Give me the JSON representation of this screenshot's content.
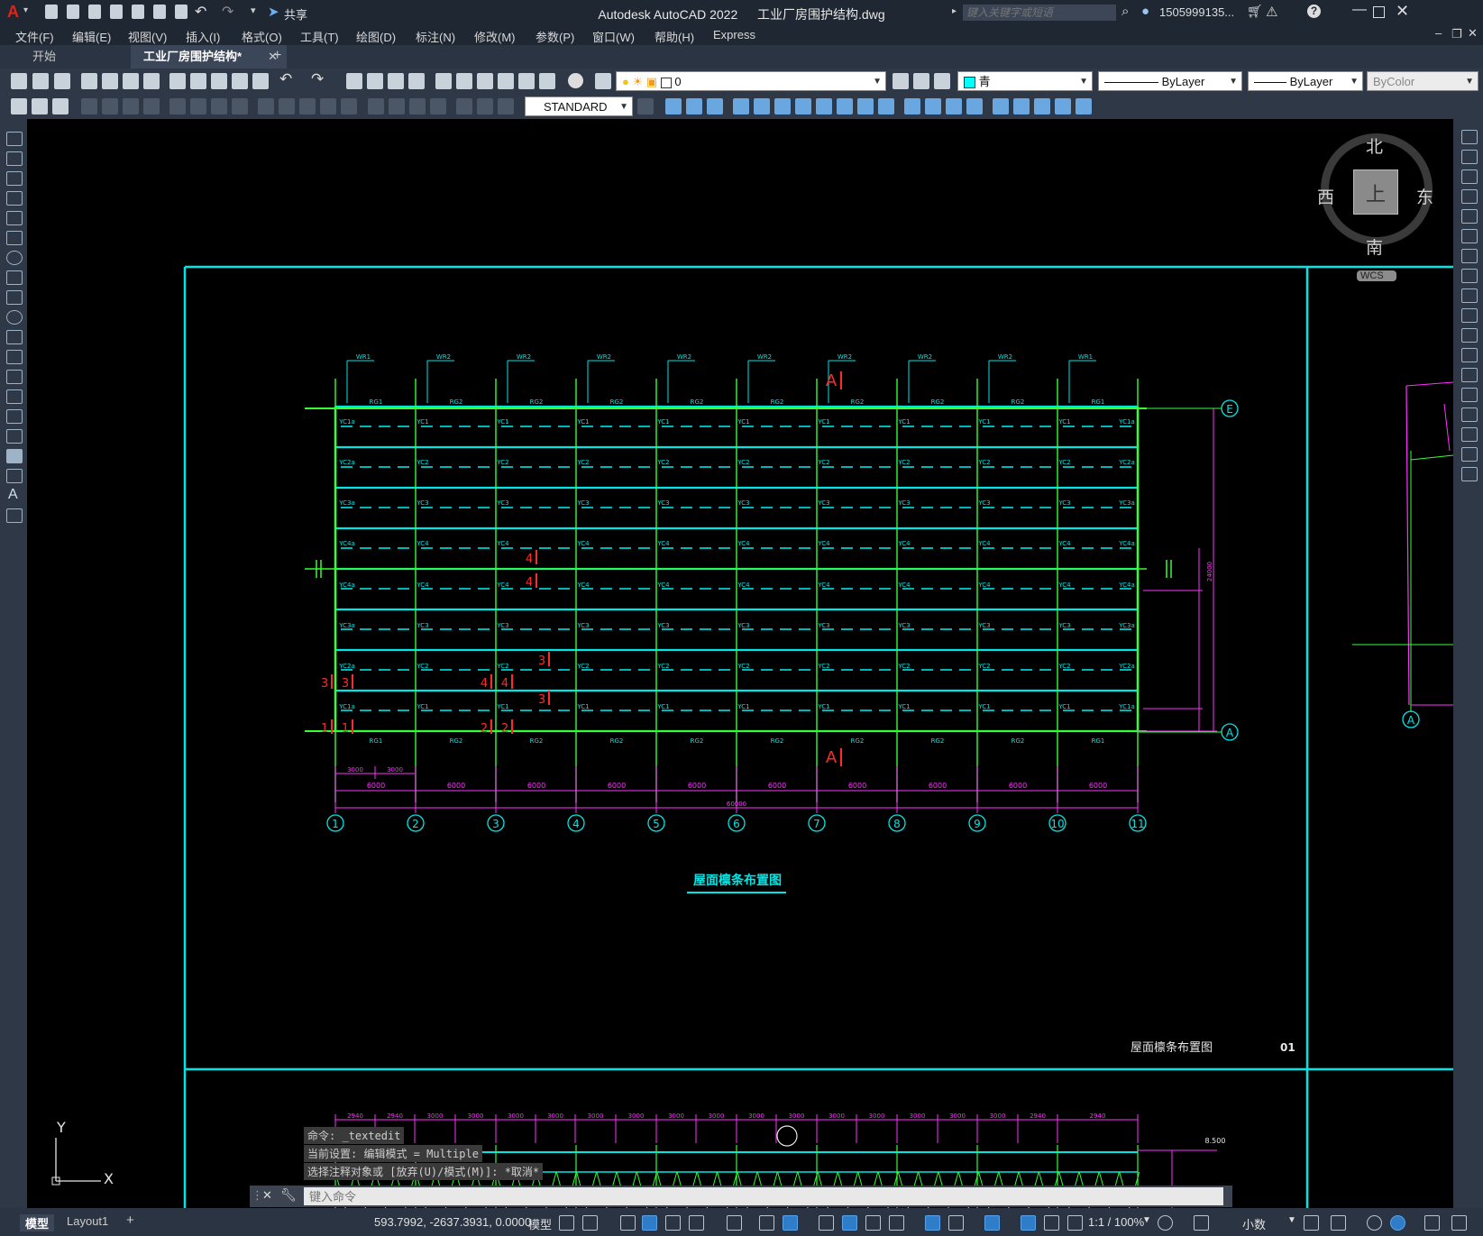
{
  "app": {
    "title": "Autodesk AutoCAD 2022",
    "filename": "工业厂房围护结构.dwg",
    "logo": "A",
    "share_label": "共享",
    "search_placeholder": "键入关键字或短语",
    "user": "1505999135...",
    "help": "?"
  },
  "menu": [
    "文件(F)",
    "编辑(E)",
    "视图(V)",
    "插入(I)",
    "格式(O)",
    "工具(T)",
    "绘图(D)",
    "标注(N)",
    "修改(M)",
    "参数(P)",
    "窗口(W)",
    "帮助(H)",
    "Express"
  ],
  "tabs": [
    {
      "label": "开始",
      "active": false
    },
    {
      "label": "工业厂房围护结构*",
      "active": true
    }
  ],
  "toolbar": {
    "layer_value": "0",
    "color_value": "青",
    "linetype_value": "ByLayer",
    "lineweight_value": "ByLayer",
    "plotstyle_value": "ByColor",
    "textstyle_value": "STANDARD"
  },
  "viewcube": {
    "north": "北",
    "south": "南",
    "east": "东",
    "west": "西",
    "face": "上",
    "wcs": "WCS"
  },
  "drawing": {
    "top_labels": [
      "WR1",
      "WR2",
      "WR2",
      "WR2",
      "WR2",
      "WR2",
      "WR2",
      "WR2",
      "WR2",
      "WR1"
    ],
    "rg_labels": [
      "RG1",
      "RG2",
      "RG2",
      "RG2",
      "RG2",
      "RG2",
      "RG2",
      "RG2",
      "RG2",
      "RG1"
    ],
    "row_labels_left": [
      "YC1a",
      "YC2a",
      "YC3a",
      "YC4a",
      "YC4a",
      "YC3a",
      "YC2a",
      "YC1a"
    ],
    "row_labels_inner": [
      "YC1",
      "YC2",
      "YC3",
      "YC4",
      "YC4",
      "YC3",
      "YC2",
      "YC1"
    ],
    "row_labels_right": [
      "YC1a",
      "YC2a",
      "YC3a",
      "YC4a",
      "YC4a",
      "YC3a",
      "YC2a",
      "YC1a"
    ],
    "section_mark": "A",
    "axis_numbers": [
      "1",
      "2",
      "3",
      "4",
      "5",
      "6",
      "7",
      "8",
      "9",
      "10",
      "11"
    ],
    "axis_letters": [
      "E",
      "A"
    ],
    "span_dims": [
      "6000",
      "6000",
      "6000",
      "6000",
      "6000",
      "6000",
      "6000",
      "6000",
      "6000",
      "6000"
    ],
    "sub_dims": [
      "3000",
      "3000"
    ],
    "total_dim": "60000",
    "right_dim": "24000",
    "red_marks": [
      "4",
      "4",
      "3",
      "3",
      "3",
      "3",
      "4",
      "4",
      "1",
      "1",
      "2",
      "2"
    ],
    "drawing_title": "屋面檩条布置图",
    "sheet_title": "屋面檩条布置图",
    "sheet_no": "01",
    "lower_dims": [
      "2940",
      "2940",
      "3000",
      "3000",
      "3000",
      "3000",
      "3000",
      "3000",
      "3000",
      "3000",
      "3000",
      "3000",
      "3000",
      "3000",
      "3000",
      "3000",
      "3000",
      "2940",
      "2940"
    ],
    "lower_elev": "8.500"
  },
  "ucs": {
    "x": "X",
    "y": "Y"
  },
  "command": {
    "history": [
      "命令: _textedit",
      "当前设置: 编辑模式 = Multiple",
      "选择注释对象或 [放弃(U)/模式(M)]: *取消*"
    ],
    "placeholder": "键入命令"
  },
  "status": {
    "layout_tabs": [
      "模型",
      "Layout1"
    ],
    "coords": "593.7992, -2637.3931, 0.0000",
    "space": "模型",
    "scale": "1:1 / 100%",
    "units": "小数"
  }
}
